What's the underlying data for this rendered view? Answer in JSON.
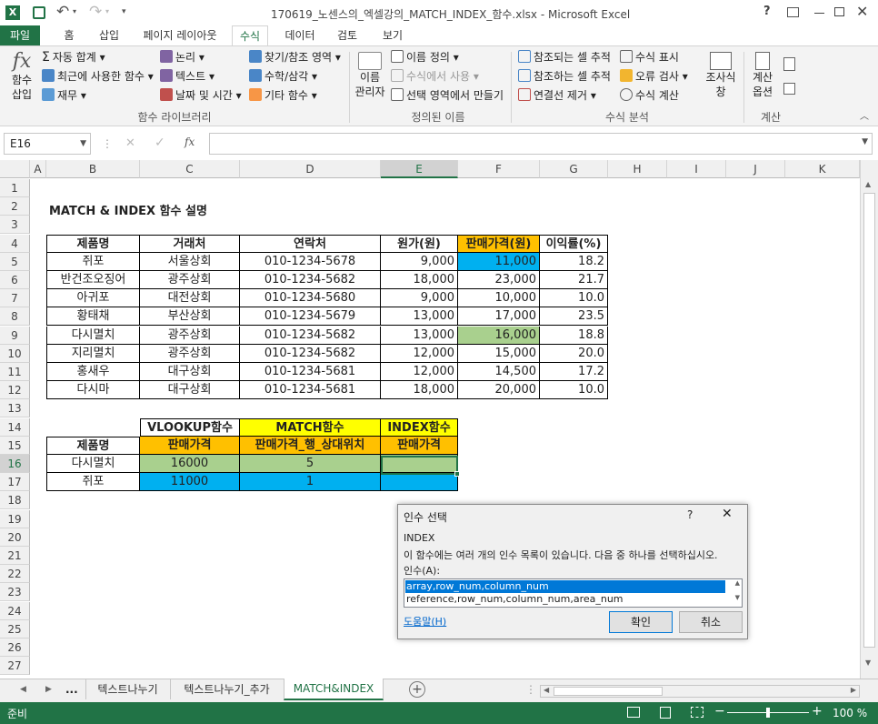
{
  "titlebar": {
    "doc_title": "170619_노센스의_엑셀강의_MATCH_INDEX_함수.xlsx - Microsoft Excel",
    "undo": "↶",
    "redo": "↷",
    "help": "?"
  },
  "tabs": [
    "파일",
    "홈",
    "삽입",
    "페이지 레이아웃",
    "수식",
    "데이터",
    "검토",
    "보기"
  ],
  "ribbon": {
    "fx_btn": [
      "함수",
      "삽입"
    ],
    "lib": {
      "autosum": "자동 합계",
      "recent": "최근에 사용한 함수",
      "finance": "재무",
      "logic": "논리",
      "text": "텍스트",
      "datetime": "날짜 및 시간",
      "lookup": "찾기/참조 영역",
      "math": "수학/삼각",
      "more": "기타 함수",
      "label": "함수 라이브러리"
    },
    "names": {
      "manager": [
        "이름",
        "관리자"
      ],
      "define": "이름 정의",
      "use": "수식에서 사용",
      "create": "선택 영역에서 만들기",
      "label": "정의된 이름"
    },
    "audit": {
      "prec": "참조되는 셀 추적",
      "dep": "참조하는 셀 추적",
      "remove": "연결선 제거",
      "show": "수식 표시",
      "check": "오류 검사",
      "eval": "수식 계산",
      "watch": [
        "조사식",
        "창"
      ],
      "label": "수식 분석"
    },
    "calc": {
      "options": [
        "계산",
        "옵션"
      ],
      "label": "계산"
    }
  },
  "formula_bar": {
    "name_box": "E16",
    "formula": ""
  },
  "columns": [
    "A",
    "B",
    "C",
    "D",
    "E",
    "F",
    "G",
    "H",
    "I",
    "J",
    "K"
  ],
  "rows": [
    "1",
    "2",
    "3",
    "4",
    "5",
    "6",
    "7",
    "8",
    "9",
    "10",
    "11",
    "12",
    "13",
    "14",
    "15",
    "16",
    "17",
    "18",
    "19",
    "20",
    "21",
    "22",
    "23",
    "24",
    "25",
    "26",
    "27"
  ],
  "sheet": {
    "title": "MATCH & INDEX 함수 설명",
    "headers": [
      "제품명",
      "거래처",
      "연락처",
      "원가(원)",
      "판매가격(원)",
      "이익률(%)"
    ],
    "table": [
      [
        "쥐포",
        "서울상회",
        "010-1234-5678",
        "9,000",
        "11,000",
        "18.2"
      ],
      [
        "반건조오징어",
        "광주상회",
        "010-1234-5682",
        "18,000",
        "23,000",
        "21.7"
      ],
      [
        "아귀포",
        "대전상회",
        "010-1234-5680",
        "9,000",
        "10,000",
        "10.0"
      ],
      [
        "황태채",
        "부산상회",
        "010-1234-5679",
        "13,000",
        "17,000",
        "23.5"
      ],
      [
        "다시멸치",
        "광주상회",
        "010-1234-5682",
        "13,000",
        "16,000",
        "18.8"
      ],
      [
        "지리멸치",
        "광주상회",
        "010-1234-5682",
        "12,000",
        "15,000",
        "20.0"
      ],
      [
        "홍새우",
        "대구상회",
        "010-1234-5681",
        "12,000",
        "14,500",
        "17.2"
      ],
      [
        "다시마",
        "대구상회",
        "010-1234-5681",
        "18,000",
        "20,000",
        "10.0"
      ]
    ],
    "lookup_top": [
      "VLOOKUP함수",
      "MATCH함수",
      "INDEX함수"
    ],
    "lookup_sub": [
      "제품명",
      "판매가격",
      "판매가격_행_상대위치",
      "판매가격"
    ],
    "lookup_rows": [
      [
        "다시멸치",
        "16000",
        "5",
        ""
      ],
      [
        "쥐포",
        "11000",
        "1",
        ""
      ]
    ]
  },
  "dialog": {
    "title": "인수 선택",
    "help": "?",
    "close": "✕",
    "func": "INDEX",
    "desc": "이 함수에는 여러 개의 인수 목록이 있습니다. 다음 중 하나를 선택하십시오.",
    "args_label": "인수(A):",
    "options": [
      "array,row_num,column_num",
      "reference,row_num,column_num,area_num"
    ],
    "help_link": "도움말(H)",
    "ok": "확인",
    "cancel": "취소"
  },
  "sheet_tabs": {
    "more": "...",
    "tabs": [
      "텍스트나누기",
      "텍스트나누기_추가",
      "MATCH&INDEX"
    ],
    "active": 2
  },
  "status": {
    "ready": "준비",
    "zoom": "100 %",
    "zoom_level": 1.0
  },
  "colors": {
    "excel_green": "#217346",
    "orange": "#ffc000",
    "blue": "#00b0f0",
    "green": "#a9d08e",
    "yellow": "#ffff00"
  }
}
